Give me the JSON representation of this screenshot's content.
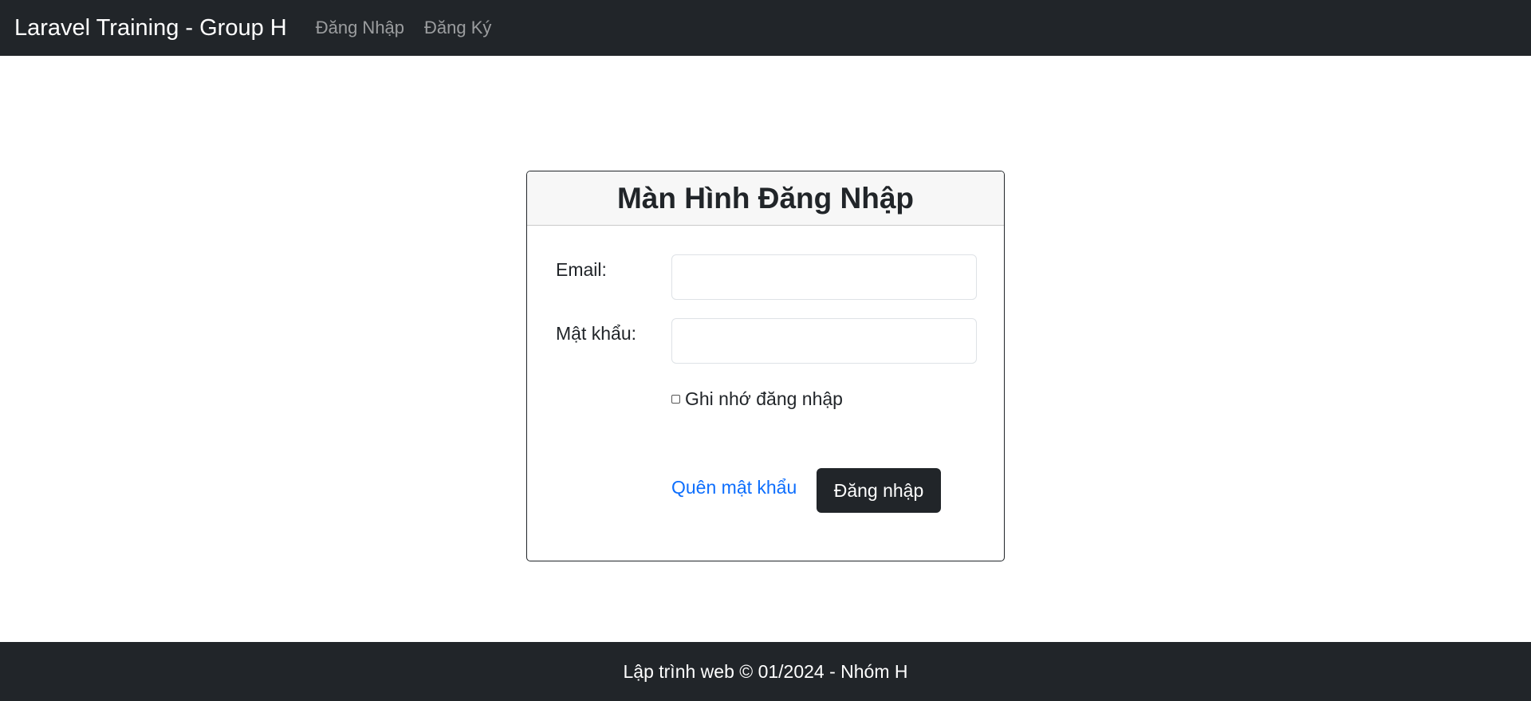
{
  "navbar": {
    "brand": "Laravel Training - Group H",
    "links": [
      {
        "label": "Đăng Nhập"
      },
      {
        "label": "Đăng Ký"
      }
    ]
  },
  "login_card": {
    "title": "Màn Hình Đăng Nhập",
    "email": {
      "label": "Email:",
      "value": "",
      "placeholder": ""
    },
    "password": {
      "label": "Mật khẩu:",
      "value": "",
      "placeholder": ""
    },
    "remember": {
      "label": "Ghi nhớ đăng nhập",
      "checked": false
    },
    "forgot_link": "Quên mật khẩu",
    "submit_label": "Đăng nhập"
  },
  "footer": {
    "text": "Lập trình web © 01/2024 - Nhóm H"
  },
  "colors": {
    "dark": "#212529",
    "link": "#0d6efd",
    "header_bg": "#f7f7f7"
  }
}
